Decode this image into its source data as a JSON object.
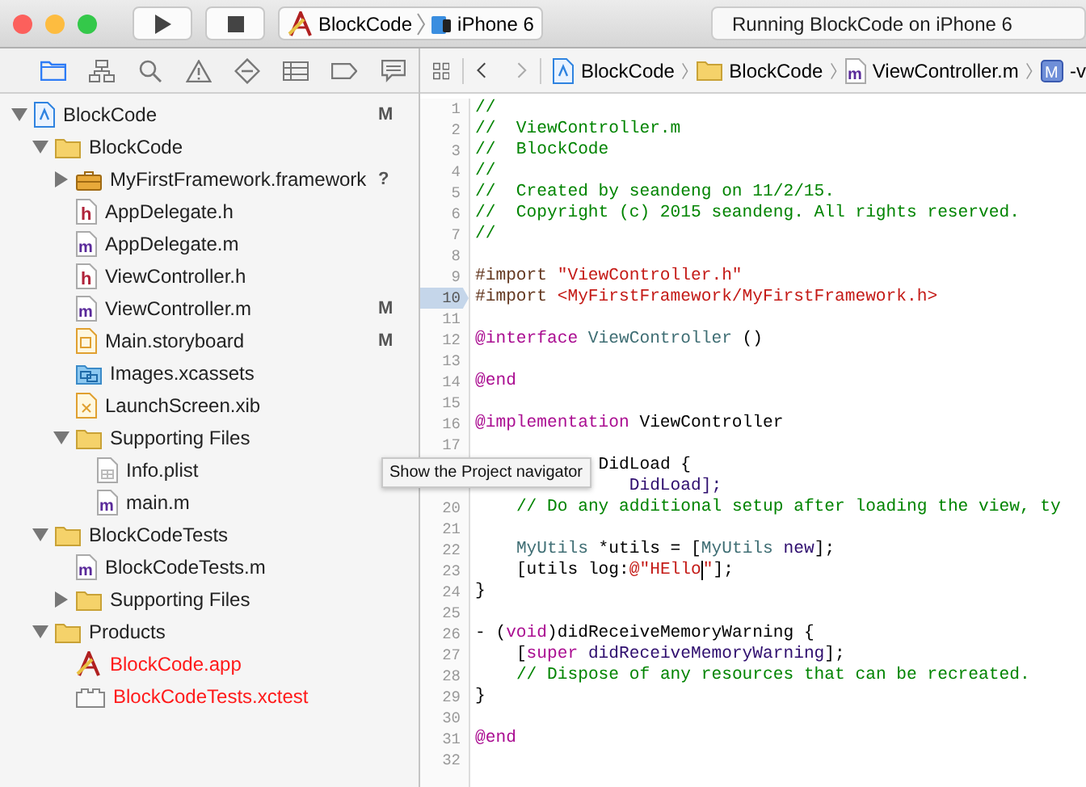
{
  "toolbar": {
    "scheme": {
      "target": "BlockCode",
      "device": "iPhone 6"
    },
    "activity": "Running BlockCode on iPhone 6"
  },
  "navigator": {
    "tabs": [
      {
        "selected": true
      },
      {
        "selected": false
      },
      {
        "selected": false
      },
      {
        "selected": false
      },
      {
        "selected": false
      },
      {
        "selected": false
      },
      {
        "selected": false
      },
      {
        "selected": false
      }
    ],
    "tree": [
      {
        "name": "BlockCode",
        "kind": "project",
        "status": "M",
        "expanded": true,
        "missing": false,
        "children": [
          {
            "name": "BlockCode",
            "kind": "folder",
            "expanded": true,
            "missing": false,
            "children": [
              {
                "name": "MyFirstFramework.framework",
                "kind": "framework",
                "status": "?",
                "expanded": false,
                "missing": false
              },
              {
                "name": "AppDelegate.h",
                "kind": "h",
                "missing": false
              },
              {
                "name": "AppDelegate.m",
                "kind": "m",
                "missing": false
              },
              {
                "name": "ViewController.h",
                "kind": "h",
                "missing": false
              },
              {
                "name": "ViewController.m",
                "kind": "m",
                "status": "M",
                "missing": false
              },
              {
                "name": "Main.storyboard",
                "kind": "storyboard",
                "status": "M",
                "missing": false
              },
              {
                "name": "Images.xcassets",
                "kind": "assets",
                "missing": false
              },
              {
                "name": "LaunchScreen.xib",
                "kind": "xib",
                "missing": false
              },
              {
                "name": "Supporting Files",
                "kind": "folder",
                "expanded": true,
                "missing": false,
                "children": [
                  {
                    "name": "Info.plist",
                    "kind": "plist",
                    "missing": false
                  },
                  {
                    "name": "main.m",
                    "kind": "m",
                    "missing": false
                  }
                ]
              }
            ]
          },
          {
            "name": "BlockCodeTests",
            "kind": "folder",
            "expanded": true,
            "missing": false,
            "children": [
              {
                "name": "BlockCodeTests.m",
                "kind": "m",
                "missing": false
              },
              {
                "name": "Supporting Files",
                "kind": "folder",
                "expanded": false,
                "missing": false
              }
            ]
          },
          {
            "name": "Products",
            "kind": "folder",
            "expanded": true,
            "missing": false,
            "children": [
              {
                "name": "BlockCode.app",
                "kind": "app",
                "missing": true
              },
              {
                "name": "BlockCodeTests.xctest",
                "kind": "xctest",
                "missing": true
              }
            ]
          }
        ]
      }
    ]
  },
  "jump_bar": {
    "path": [
      {
        "label": "BlockCode",
        "kind": "project"
      },
      {
        "label": "BlockCode",
        "kind": "folder"
      },
      {
        "label": "ViewController.m",
        "kind": "m"
      },
      {
        "label": "-v",
        "kind": "M"
      }
    ]
  },
  "editor": {
    "lines": [
      {
        "number": "1",
        "selected": false,
        "tokens": [
          {
            "text": "//",
            "kind": "comment"
          }
        ]
      },
      {
        "number": "2",
        "selected": false,
        "tokens": [
          {
            "text": "//  ViewController.m",
            "kind": "comment"
          }
        ]
      },
      {
        "number": "3",
        "selected": false,
        "tokens": [
          {
            "text": "//  BlockCode",
            "kind": "comment"
          }
        ]
      },
      {
        "number": "4",
        "selected": false,
        "tokens": [
          {
            "text": "//",
            "kind": "comment"
          }
        ]
      },
      {
        "number": "5",
        "selected": false,
        "tokens": [
          {
            "text": "//  Created by seandeng on 11/2/15.",
            "kind": "comment"
          }
        ]
      },
      {
        "number": "6",
        "selected": false,
        "tokens": [
          {
            "text": "//  Copyright (c) 2015 seandeng. All rights reserved.",
            "kind": "comment"
          }
        ]
      },
      {
        "number": "7",
        "selected": false,
        "tokens": [
          {
            "text": "//",
            "kind": "comment"
          }
        ]
      },
      {
        "number": "8",
        "selected": false
      },
      {
        "number": "9",
        "selected": false,
        "tokens": [
          {
            "text": "#import ",
            "kind": "directive"
          },
          {
            "text": "\"ViewController.h\"",
            "kind": "string"
          }
        ]
      },
      {
        "number": "10",
        "selected": true,
        "tokens": [
          {
            "text": "#import ",
            "kind": "directive"
          },
          {
            "text": "<MyFirstFramework/MyFirstFramework.h>",
            "kind": "string"
          }
        ]
      },
      {
        "number": "11",
        "selected": false
      },
      {
        "number": "12",
        "selected": false,
        "tokens": [
          {
            "text": "@interface",
            "kind": "keyword"
          },
          {
            "text": " ViewController",
            "kind": "class"
          },
          {
            "text": " ()",
            "kind": "plain"
          }
        ]
      },
      {
        "number": "13",
        "selected": false
      },
      {
        "number": "14",
        "selected": false,
        "tokens": [
          {
            "text": "@end",
            "kind": "keyword"
          }
        ]
      },
      {
        "number": "15",
        "selected": false
      },
      {
        "number": "16",
        "selected": false,
        "tokens": [
          {
            "text": "@implementation",
            "kind": "keyword"
          },
          {
            "text": " ViewController",
            "kind": "plain"
          }
        ]
      },
      {
        "number": "17",
        "selected": false
      },
      {
        "tokens": [
          {
            "text": "            DidLoad {",
            "kind": "plain"
          }
        ]
      },
      {
        "tokens": [
          {
            "text": "               DidLoad];",
            "kind": "method"
          }
        ]
      },
      {
        "number": "20",
        "selected": false,
        "tokens": [
          {
            "text": "    // Do any additional setup after loading the view, ty",
            "kind": "comment"
          }
        ]
      },
      {
        "number": "21",
        "selected": false
      },
      {
        "number": "22",
        "selected": false,
        "tokens": [
          {
            "text": "    MyUtils",
            "kind": "class"
          },
          {
            "text": " *utils = [",
            "kind": "plain"
          },
          {
            "text": "MyUtils",
            "kind": "class"
          },
          {
            "text": " new",
            "kind": "method"
          },
          {
            "text": "];",
            "kind": "plain"
          }
        ]
      },
      {
        "number": "23",
        "selected": false,
        "tokens": [
          {
            "text": "    [utils log:",
            "kind": "plain"
          },
          {
            "text": "@\"HEllo",
            "kind": "string"
          },
          {
            "text": "\"",
            "kind": "string",
            "cursor": true
          },
          {
            "text": "];",
            "kind": "plain"
          }
        ]
      },
      {
        "number": "24",
        "selected": false,
        "tokens": [
          {
            "text": "}",
            "kind": "plain"
          }
        ]
      },
      {
        "number": "25",
        "selected": false
      },
      {
        "number": "26",
        "selected": false,
        "tokens": [
          {
            "text": "- (",
            "kind": "plain"
          },
          {
            "text": "void",
            "kind": "keyword"
          },
          {
            "text": ")didReceiveMemoryWarning {",
            "kind": "plain"
          }
        ]
      },
      {
        "number": "27",
        "selected": false,
        "tokens": [
          {
            "text": "    [",
            "kind": "plain"
          },
          {
            "text": "super",
            "kind": "keyword"
          },
          {
            "text": " didReceiveMemoryWarning",
            "kind": "method"
          },
          {
            "text": "];",
            "kind": "plain"
          }
        ]
      },
      {
        "number": "28",
        "selected": false,
        "tokens": [
          {
            "text": "    // Dispose of any resources that can be recreated.",
            "kind": "comment"
          }
        ]
      },
      {
        "number": "29",
        "selected": false,
        "tokens": [
          {
            "text": "}",
            "kind": "plain"
          }
        ]
      },
      {
        "number": "30",
        "selected": false
      },
      {
        "number": "31",
        "selected": false,
        "tokens": [
          {
            "text": "@end",
            "kind": "keyword"
          }
        ]
      },
      {
        "number": "32",
        "selected": false
      }
    ]
  },
  "tooltip": "Show the Project navigator"
}
